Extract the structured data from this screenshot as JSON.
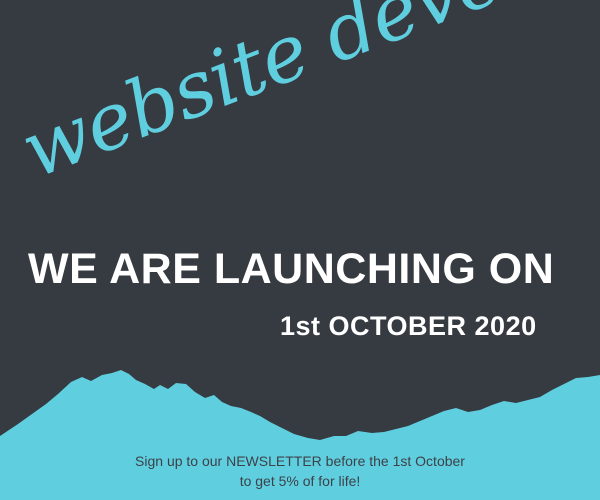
{
  "theme": {
    "background": "#363a41",
    "accent": "#5fcfe0",
    "text_white": "#ffffff",
    "text_dark": "#3d4148"
  },
  "banner": {
    "script_title": "website development",
    "headline": "WE ARE LAUNCHING ON",
    "date": "1st OCTOBER 2020",
    "newsletter_line_1": "Sign up to our NEWSLETTER before the 1st October",
    "newsletter_line_2": "to get 5% of for life!"
  }
}
